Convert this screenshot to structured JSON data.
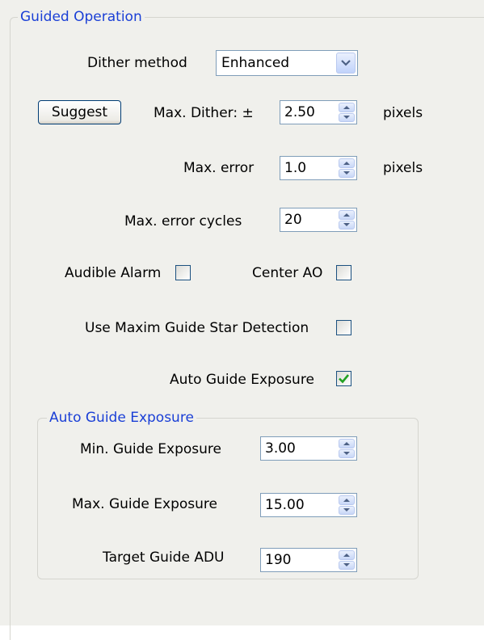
{
  "guided_operation": {
    "legend": "Guided Operation",
    "dither_method": {
      "label": "Dither method",
      "value": "Enhanced"
    },
    "suggest_label": "Suggest",
    "max_dither": {
      "label": "Max. Dither: ±",
      "value": "2.50",
      "unit": "pixels"
    },
    "max_error": {
      "label": "Max. error",
      "value": "1.0",
      "unit": "pixels"
    },
    "max_error_cycles": {
      "label": "Max. error cycles",
      "value": "20"
    },
    "audible_alarm": {
      "label": "Audible Alarm",
      "checked": false
    },
    "center_ao": {
      "label": "Center AO",
      "checked": false
    },
    "use_maxim": {
      "label": "Use Maxim Guide Star Detection",
      "checked": false
    },
    "auto_guide_exposure": {
      "label": "Auto Guide Exposure",
      "checked": true
    }
  },
  "auto_guide_group": {
    "legend": "Auto Guide Exposure",
    "min_exposure": {
      "label": "Min. Guide Exposure",
      "value": "3.00"
    },
    "max_exposure": {
      "label": "Max. Guide Exposure",
      "value": "15.00"
    },
    "target_adu": {
      "label": "Target Guide ADU",
      "value": "190"
    }
  },
  "colors": {
    "legend": "#1a3fd6",
    "panel": "#f0f0ec",
    "check_mark": "#21a121"
  }
}
